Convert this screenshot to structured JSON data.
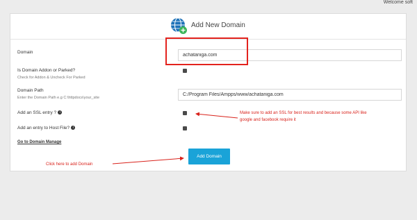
{
  "brand": "Welcome soft",
  "form": {
    "title": "Add New Domain",
    "domain": {
      "label": "Domain",
      "value": "achataniga.com"
    },
    "addon": {
      "label": "Is Domain Addon or Parked?",
      "help": "Check for Addon & Uncheck For Parked"
    },
    "path": {
      "label": "Domain Path",
      "help": "Enter the Domain Path e.g C:\\httpdocs\\your_site",
      "value": "C:/Program Files/Ampps/www/achataniga.com"
    },
    "ssl": {
      "label": "Add an SSL entry ?"
    },
    "host": {
      "label": "Add an entry to Host File?"
    },
    "manage_link": "Go to Domain Manage",
    "submit": "Add Domain"
  },
  "annotations": {
    "ssl_note_line1": "Make sure to add an SSL for best results and because some API like",
    "ssl_note_line2": "google and facebook require it",
    "click_note": "Click here to add Domain",
    "color": "#d9221b"
  },
  "icons": {
    "header": "globe-plus-icon",
    "info": "info-icon"
  }
}
